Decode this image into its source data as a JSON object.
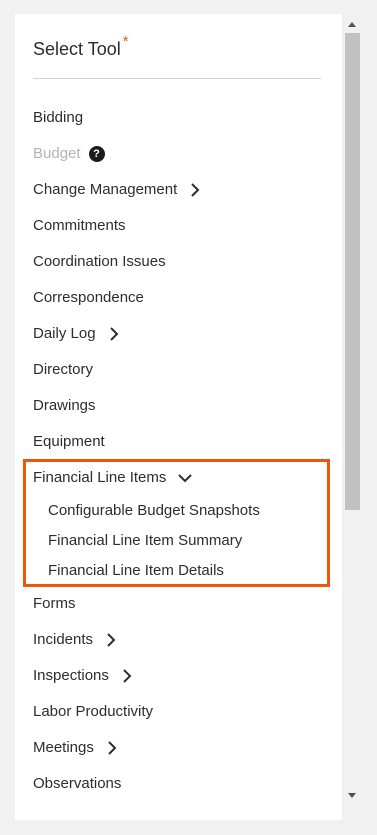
{
  "header": {
    "title": "Select Tool",
    "required_mark": "*"
  },
  "items": [
    {
      "label": "Bidding"
    },
    {
      "label": "Budget"
    },
    {
      "label": "Change Management"
    },
    {
      "label": "Commitments"
    },
    {
      "label": "Coordination Issues"
    },
    {
      "label": "Correspondence"
    },
    {
      "label": "Daily Log"
    },
    {
      "label": "Directory"
    },
    {
      "label": "Drawings"
    },
    {
      "label": "Equipment"
    },
    {
      "label": "Financial Line Items"
    },
    {
      "label": "Configurable Budget Snapshots"
    },
    {
      "label": "Financial Line Item Summary"
    },
    {
      "label": "Financial Line Item Details"
    },
    {
      "label": "Forms"
    },
    {
      "label": "Incidents"
    },
    {
      "label": "Inspections"
    },
    {
      "label": "Labor Productivity"
    },
    {
      "label": "Meetings"
    },
    {
      "label": "Observations"
    }
  ],
  "budget_help": "?",
  "colors": {
    "highlight": "#f0560a",
    "required": "#e8600f",
    "disabled_text": "#b3b3b3"
  }
}
